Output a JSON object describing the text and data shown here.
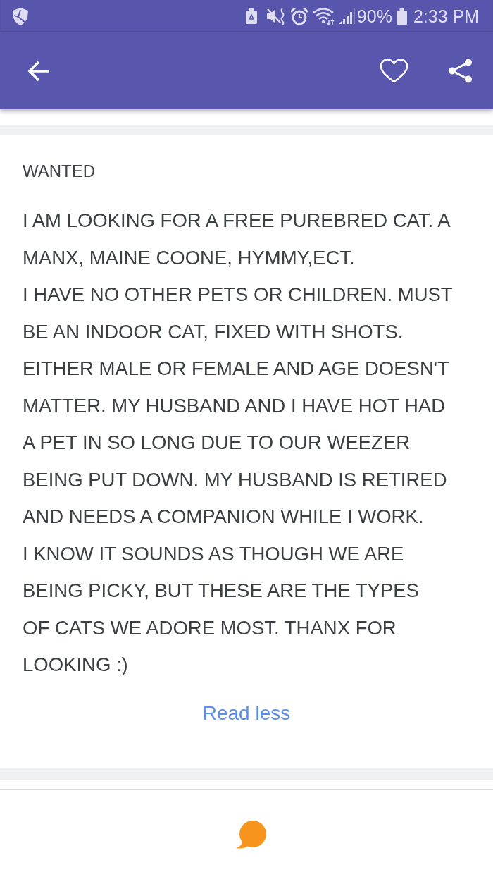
{
  "status_bar": {
    "battery_percent": "90%",
    "time": "2:33 PM"
  },
  "toolbar": {
    "favorite": {
      "selected": false
    }
  },
  "listing": {
    "category": "WANTED",
    "description": "I AM LOOKING FOR A FREE PUREBRED CAT. A MANX, MAINE COONE, HYMMY,ECT.\nI HAVE NO OTHER PETS OR CHILDREN. MUST BE AN INDOOR CAT, FIXED WITH SHOTS. EITHER MALE OR FEMALE AND AGE DOESN'T MATTER. MY HUSBAND AND I HAVE HOT HAD A PET IN SO LONG DUE TO OUR WEEZER BEING PUT DOWN. MY HUSBAND IS RETIRED AND NEEDS A COMPANION WHILE I WORK.\nI KNOW IT SOUNDS AS THOUGH WE ARE BEING PICKY, BUT THESE ARE THE TYPES\nOF CATS WE ADORE MOST. THANX FOR LOOKING :)",
    "toggle": "Read less"
  }
}
